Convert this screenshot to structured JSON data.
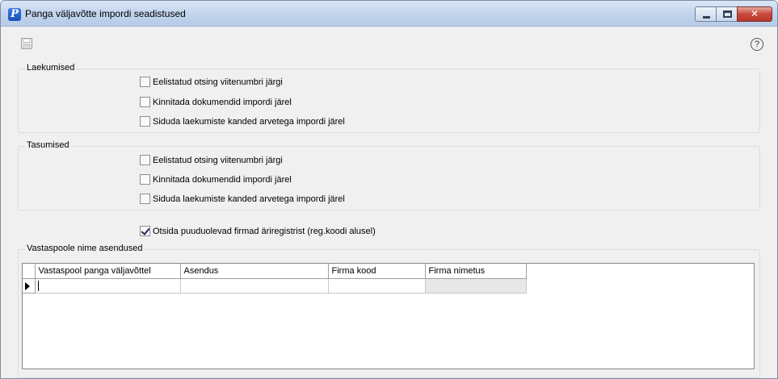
{
  "window": {
    "title": "Panga väljavõtte impordi seadistused",
    "app_icon_letter": "P",
    "close_glyph": "✕"
  },
  "toolbar": {
    "help_glyph": "?"
  },
  "laekumised": {
    "title": "Laekumised",
    "options": [
      {
        "label": "Eelistatud otsing viitenumbri järgi",
        "checked": false
      },
      {
        "label": "Kinnitada dokumendid impordi järel",
        "checked": false
      },
      {
        "label": "Siduda laekumiste kanded arvetega impordi järel",
        "checked": false
      }
    ]
  },
  "tasumised": {
    "title": "Tasumised",
    "options": [
      {
        "label": "Eelistatud otsing viitenumbri järgi",
        "checked": false
      },
      {
        "label": "Kinnitada dokumendid impordi järel",
        "checked": false
      },
      {
        "label": "Siduda laekumiste kanded arvetega impordi järel",
        "checked": false
      }
    ]
  },
  "registry_option": {
    "label": "Otsida puuduolevad firmad äriregistrist (reg.koodi alusel)",
    "checked": true
  },
  "replacements": {
    "title": "Vastaspoole nime asendused",
    "columns": [
      "Vastaspool panga väljavõttel",
      "Asendus",
      "Firma kood",
      "Firma nimetus"
    ],
    "rows": [
      [
        "",
        "",
        "",
        ""
      ]
    ]
  },
  "colors": {
    "group_border": "#d5dfe5",
    "window_bg": "#f0f0f0",
    "close_button": "#c8483a"
  }
}
